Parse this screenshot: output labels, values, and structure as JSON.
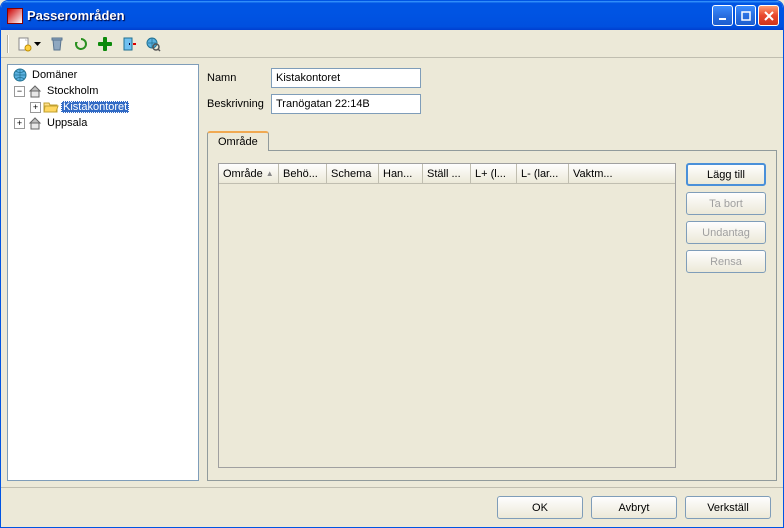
{
  "window": {
    "title": "Passerområden"
  },
  "tree": {
    "root": {
      "label": "Domäner"
    },
    "n0": {
      "label": "Stockholm"
    },
    "n0_0": {
      "label": "Kistakontoret"
    },
    "n1": {
      "label": "Uppsala"
    }
  },
  "form": {
    "name_label": "Namn",
    "name_value": "Kistakontoret",
    "desc_label": "Beskrivning",
    "desc_value": "Tranögatan 22:14B"
  },
  "tabs": {
    "tab0": "Område"
  },
  "grid": {
    "col0": "Område",
    "col1": "Behö...",
    "col2": "Schema",
    "col3": "Han...",
    "col4": "Ställ ...",
    "col5": "L+ (l...",
    "col6": "L- (lar...",
    "col7": "Vaktm..."
  },
  "aside": {
    "add": "Lägg till",
    "remove": "Ta bort",
    "except": "Undantag",
    "clear": "Rensa"
  },
  "footer": {
    "ok": "OK",
    "cancel": "Avbryt",
    "apply": "Verkställ"
  }
}
